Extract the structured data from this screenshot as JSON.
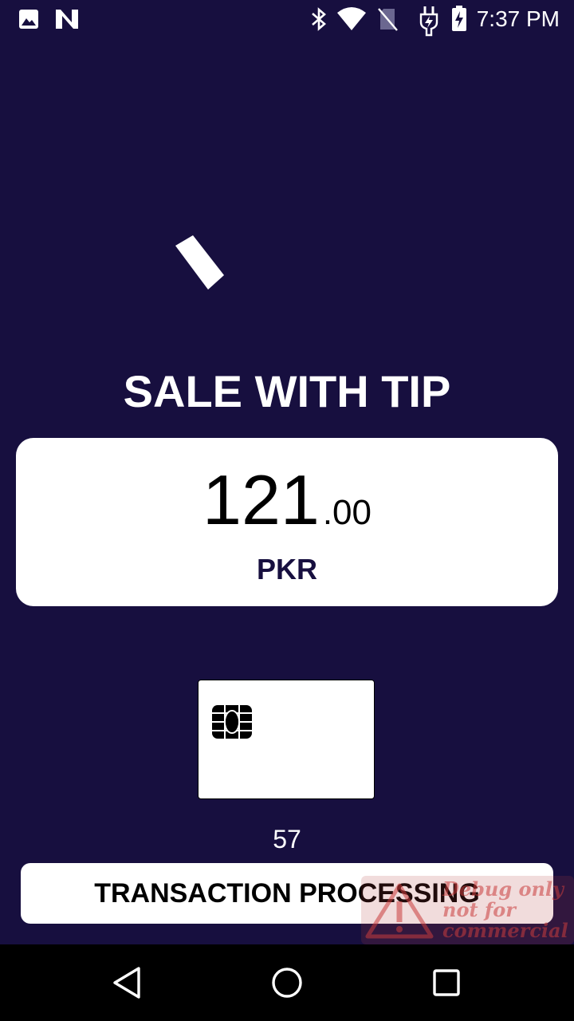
{
  "status_bar": {
    "time": "7:37 PM",
    "icons": [
      "image-icon",
      "n-notification-icon",
      "bluetooth-icon",
      "wifi-icon",
      "no-sim-icon",
      "charging-plug-icon",
      "battery-charging-icon"
    ]
  },
  "transaction": {
    "title": "SALE WITH TIP",
    "amount_integer": "121",
    "amount_decimal": ".00",
    "currency": "PKR",
    "countdown": "57",
    "status": "TRANSACTION PROCESSING"
  },
  "watermark": {
    "line1": "Debug only",
    "line2": "not for",
    "line3": "commercial"
  },
  "nav_bar": {
    "icons": [
      "back-icon",
      "home-icon",
      "recents-icon"
    ]
  },
  "colors": {
    "background": "#170f3f",
    "card": "#ffffff",
    "accent_text": "#170f3f"
  }
}
